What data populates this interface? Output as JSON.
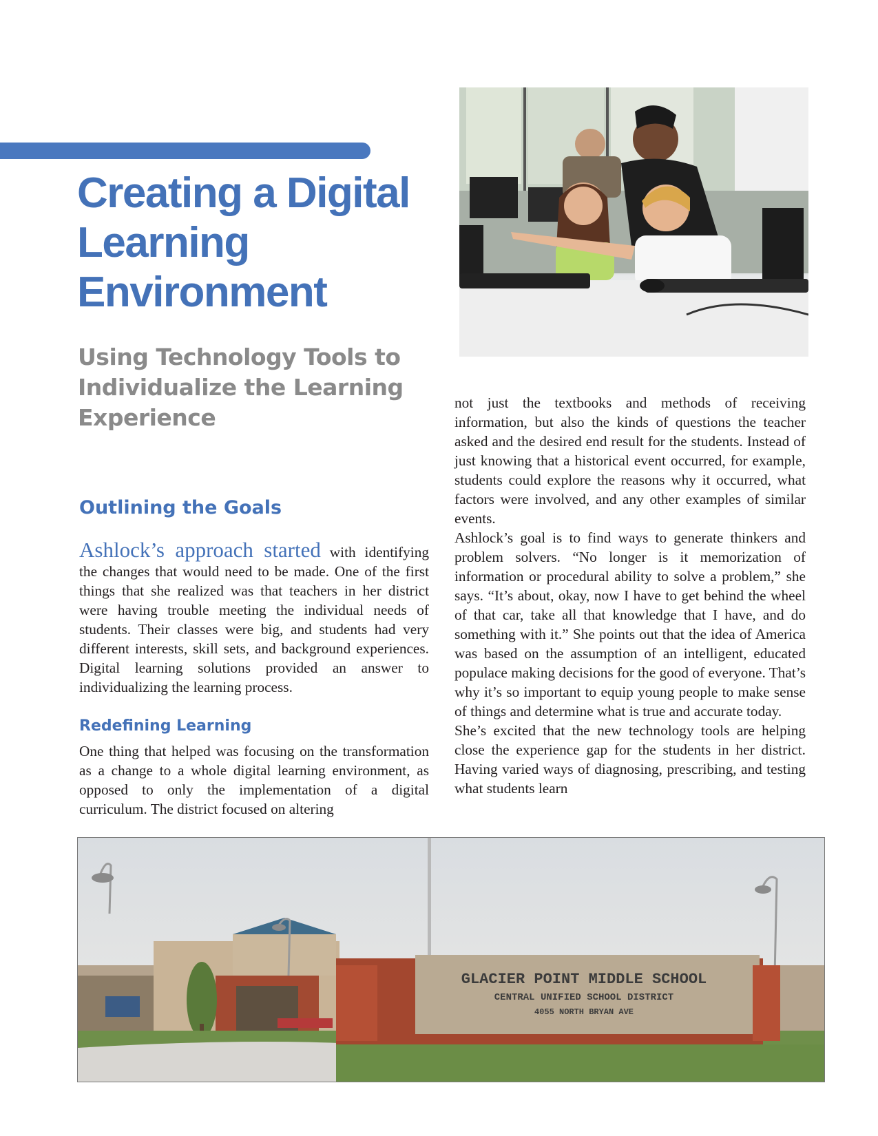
{
  "header": {
    "title": "Creating a Digital Learning Environment",
    "subtitle": "Using Technology Tools to Individualize the Learning Experience"
  },
  "section": {
    "heading": "Outlining the Goals",
    "lead": "Ashlock’s approach started",
    "paragraph1_rest": " with identifying the changes that would need to be made. One of the first things that she realized was that teachers in her district were having trouble meeting the individual needs of students. Their classes were big, and students had very different interests, skill sets, and background experiences. Digital learning solutions provided an answer to individualizing the learning process.",
    "subheading": "Redefining Learning",
    "paragraph2": "One thing that helped was focusing on the transformation as a change to a whole digital learning environment, as opposed to only the implementation of a digital curriculum. The district focused on altering"
  },
  "right_column": {
    "paragraph1": "not just the textbooks and methods of receiving information, but also the kinds of questions the teacher asked and the desired end result for the students. Instead of just knowing that a historical event occurred, for example, students could explore the reasons why it occurred, what factors were involved, and any other examples of similar events.",
    "paragraph2": "Ashlock’s goal is to find ways to generate thinkers and problem solvers. “No longer is it memorization of information or procedural ability to solve a problem,” she says. “It’s about, okay, now I have to get behind the wheel of that car, take all that knowledge that I have, and do something with it.” She points out that the idea of America was based on the assumption of an intelligent, educated populace making decisions for the good of everyone. That’s why it’s so important to equip young people to make sense of things and determine what is true and accurate today.",
    "paragraph3": "She’s excited that the new technology tools are helping close the experience gap for the students in her district. Having varied ways of diagnosing, prescribing, and testing what students learn"
  },
  "images": {
    "top_photo_icon": "classroom-photo",
    "bottom_photo_icon": "school-building-photo",
    "sign": {
      "line1": "GLACIER POINT MIDDLE SCHOOL",
      "line2": "CENTRAL UNIFIED SCHOOL DISTRICT",
      "line3": "4055 NORTH BRYAN AVE"
    }
  },
  "colors": {
    "accent": "#4472b8",
    "subtitle_gray": "#8a8a8a",
    "body_text": "#231f20"
  }
}
